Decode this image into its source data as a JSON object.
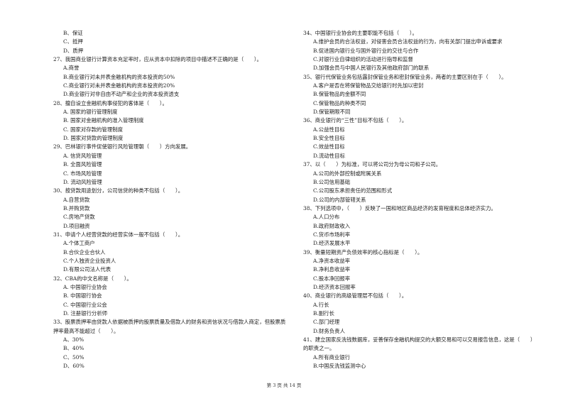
{
  "page": {
    "footer": "第 3 页 共 14 页"
  },
  "left_column": {
    "leading_options": [
      "B、保证",
      "C、抵押",
      "D、质押"
    ],
    "questions": [
      {
        "number": "27",
        "text": "27、我国商业银行计算资本充足率时，应从资本中扣除的项目中描述不正确的是（　　）。",
        "options": [
          "A.商誉",
          "B.商业银行对未并表金融机构的资本投资的50%",
          "C.商业银行对未并表金融机构的资本投资的20%",
          "D.商业银行对非自由不动产和企业的资本投资透支"
        ]
      },
      {
        "number": "28",
        "text": "28、擅自设立金融机构事侵犯的客体是（　　）。",
        "options": [
          "A. 国家的银行管理制度",
          "B. 国家对金融机构的准入管理制度",
          "C. 国家对存款的管理制度",
          "D. 国家对贷款的管理制度"
        ]
      },
      {
        "number": "29",
        "text": "29、巴林银行事件促使银行风险管理朝（　　）方向发展。",
        "options": [
          "A. 信贷风险管理",
          "B. 全面风险管理",
          "C. 市场风险管理",
          "D. 流动风险管理"
        ]
      },
      {
        "number": "30",
        "text": "30、按贷款用途划分，公司信贷的种类不包括（　　）。",
        "options": [
          "A.自营贷款",
          "B.并购贷款",
          "C.房地产贷款",
          "D.项目融资"
        ]
      },
      {
        "number": "31",
        "text": "31、申请个人经营贷款的经营实体一般不包括（　　）。",
        "options": [
          "A.个体工商户",
          "B.合伙企业合伙人",
          "C.个人独资企业投资人",
          "D.有限公司法人代表"
        ]
      },
      {
        "number": "32",
        "text": "32、CBA的中文名称是（　　）。",
        "options": [
          "A. 中国银行业协会",
          "B. 中国银行协会",
          "C. 中国银行业公会",
          "D. 注册银行分析师"
        ]
      },
      {
        "number": "33",
        "text": "33、股票质押率由贷款人依据被质押的股票质量及借款人的财务和资信状况与借款人商定，但股票质押率最高不能超过（　　）。",
        "options": [
          "A、30%",
          "B、40%",
          "C、50%",
          "D、60%"
        ]
      }
    ]
  },
  "right_column": {
    "questions": [
      {
        "number": "34",
        "text": "34、中国银行业协会的主要职能不包括（　　）。",
        "options": [
          "A.维护会员的合法权益，对侵害会员合法权益的行为，向有关部门提出申诉或要求",
          "B.促进国内银行业与国外银行业的交往与合作",
          "C.对银行业自律组织的活动进行指导和监督",
          "D.加强会员与中国人民银行及其他政府部门的联系"
        ]
      },
      {
        "number": "35",
        "text": "35、银行代保管业务包括露封保管业务和密封保管业务，两者的主要区别在于（　　）。",
        "options": [
          "A.客户是否在将保管物品交给银行时先加以密封",
          "B.保管物品的金额不同",
          "C.保管物品的种类不同",
          "D.保管期限不同"
        ]
      },
      {
        "number": "36",
        "text": "36、商业银行的“三性”目标不包括（　　）。",
        "options": [
          "A.公益性目标",
          "B.安全性目标",
          "C.效益性目标",
          "D.流动性目标"
        ]
      },
      {
        "number": "37",
        "text": "37、以（　　）为标准，可以将公司分为母公司和子公司。",
        "options": [
          "A.公司的外部控制或附属关系",
          "B.公司信用基础",
          "C.公司股东承担责任的范围和形式",
          "D.公司的内部管辖关系"
        ]
      },
      {
        "number": "38",
        "text": "38、下列选项中，（　　）反映了一国和地区商品经济的发育程度和总体经济实力。",
        "options": [
          "A.人口分布",
          "B.政府财政收入",
          "C.货币市场利率",
          "D.经济发展水平"
        ]
      },
      {
        "number": "39",
        "text": "39、衡量短期资产负债效率的核心指标是（　　）。",
        "options": [
          "A.净资本收益率",
          "B.净利息收益率",
          "C.股本净回报率",
          "D.经济资本回报率"
        ]
      },
      {
        "number": "40",
        "text": "40、商业银行的高级管理层不包括（　　）。",
        "options": [
          "A.行长",
          "B.副行长",
          "C.部门经理",
          "D.财务负责人"
        ]
      },
      {
        "number": "41",
        "text": "41、建立国家反洗钱数据库，妥善保存金融机构提交的大额交易和可以交易报告信息，这是（　　）的职责之一。",
        "options": [
          "A.所有商业银行",
          "B.中国反洗钱监测中心"
        ]
      }
    ]
  }
}
